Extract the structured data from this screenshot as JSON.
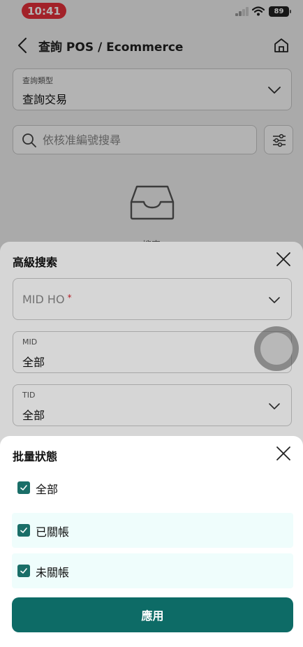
{
  "status_bar": {
    "time": "10:41",
    "battery": "89"
  },
  "navbar": {
    "title": "查詢 POS / Ecommerce"
  },
  "query_type": {
    "label": "查詢類型",
    "value": "查詢交易"
  },
  "search": {
    "placeholder": "依核准編號搜尋"
  },
  "empty_state": {
    "text": "搜索"
  },
  "advanced_search": {
    "title": "高級搜索",
    "fields": [
      {
        "placeholder": "MID HO",
        "required_mark": "*"
      },
      {
        "label": "MID",
        "value": "全部"
      },
      {
        "label": "TID",
        "value": "全部"
      }
    ]
  },
  "batch_status": {
    "title": "批量狀態",
    "options": [
      {
        "label": "全部",
        "checked": true
      },
      {
        "label": "已關帳",
        "checked": true
      },
      {
        "label": "未關帳",
        "checked": true
      }
    ],
    "apply_label": "應用"
  },
  "colors": {
    "primary": "#0d6b66",
    "checkbox": "#1a6e68",
    "time_pill": "#e8323c",
    "option_tint": "#effdfc"
  }
}
